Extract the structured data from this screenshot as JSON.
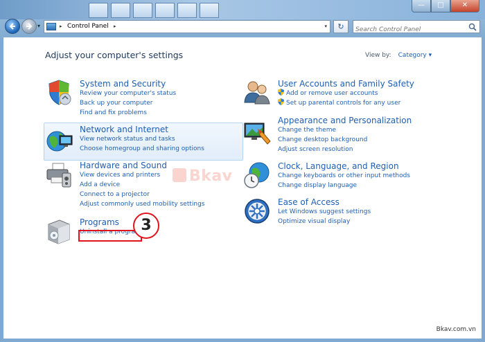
{
  "window": {
    "minimize_glyph": "—",
    "maximize_glyph": "□",
    "close_glyph": "✕"
  },
  "navbar": {
    "address_root": "Control Panel",
    "separator": "▸",
    "dropdown_glyph": "▾",
    "refresh_glyph": "↻",
    "search_placeholder": "Search Control Panel"
  },
  "header": {
    "title": "Adjust your computer's settings",
    "view_by_label": "View by:",
    "view_by_value": "Category ▾"
  },
  "categories_left": [
    {
      "title": "System and Security",
      "links": [
        "Review your computer's status",
        "Back up your computer",
        "Find and fix problems"
      ],
      "icon": "shield-icon"
    },
    {
      "title": "Network and Internet",
      "links": [
        "View network status and tasks",
        "Choose homegroup and sharing options"
      ],
      "icon": "network-globe-icon"
    },
    {
      "title": "Hardware and Sound",
      "links": [
        "View devices and printers",
        "Add a device",
        "Connect to a projector",
        "Adjust commonly used mobility settings"
      ],
      "icon": "printer-icon"
    },
    {
      "title": "Programs",
      "links": [
        "Uninstall a program"
      ],
      "icon": "programs-box-icon"
    }
  ],
  "categories_right": [
    {
      "title": "User Accounts and Family Safety",
      "links": [
        "Add or remove user accounts",
        "Set up parental controls for any user"
      ],
      "icon": "users-icon"
    },
    {
      "title": "Appearance and Personalization",
      "links": [
        "Change the theme",
        "Change desktop background",
        "Adjust screen resolution"
      ],
      "icon": "monitor-paint-icon"
    },
    {
      "title": "Clock, Language, and Region",
      "links": [
        "Change keyboards or other input methods",
        "Change display language"
      ],
      "icon": "clock-globe-icon"
    },
    {
      "title": "Ease of Access",
      "links": [
        "Let Windows suggest settings",
        "Optimize visual display"
      ],
      "icon": "ease-of-access-icon"
    }
  ],
  "annotation": {
    "step_number": "3",
    "watermark_text": "Bkav",
    "site_text": "Bkav.com.vn"
  },
  "colors": {
    "link": "#1e5fb3",
    "highlight_border": "#e0121b"
  }
}
